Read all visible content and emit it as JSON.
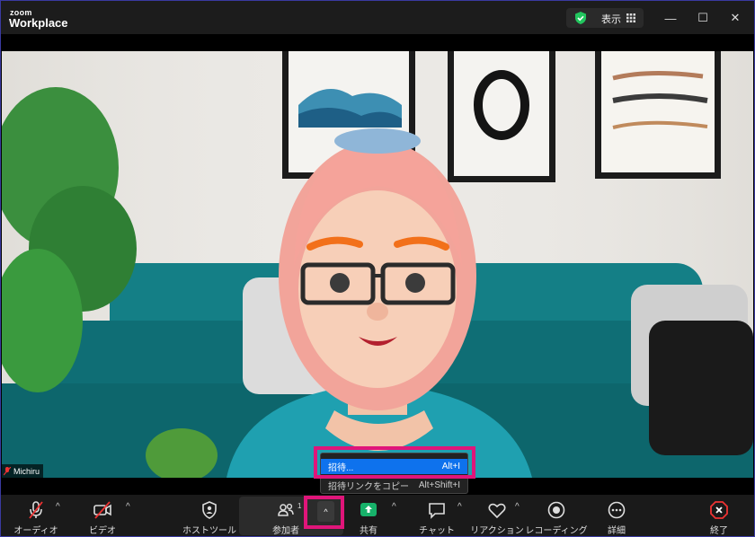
{
  "app": {
    "logo_small": "zoom",
    "logo_big": "Workplace"
  },
  "titlebar": {
    "view_label": "表示",
    "minimize": "—",
    "maximize": "☐",
    "close": "✕"
  },
  "video": {
    "participant_name": "Michiru"
  },
  "toolbar": {
    "audio": "オーディオ",
    "video": "ビデオ",
    "host_tools": "ホストツール",
    "participants": "参加者",
    "participants_count": "1",
    "share": "共有",
    "chat": "チャット",
    "reactions": "リアクション",
    "recording": "レコーディング",
    "more": "詳細",
    "end": "終了"
  },
  "menu": {
    "items": [
      {
        "label": "招待...",
        "shortcut": "Alt+I"
      },
      {
        "label": "招待リンクをコピー",
        "shortcut": "Alt+Shift+I"
      }
    ]
  },
  "colors": {
    "highlight": "#e0157a",
    "selected": "#0e72ed",
    "share_green": "#17b26a",
    "shield_green": "#22c55e"
  }
}
